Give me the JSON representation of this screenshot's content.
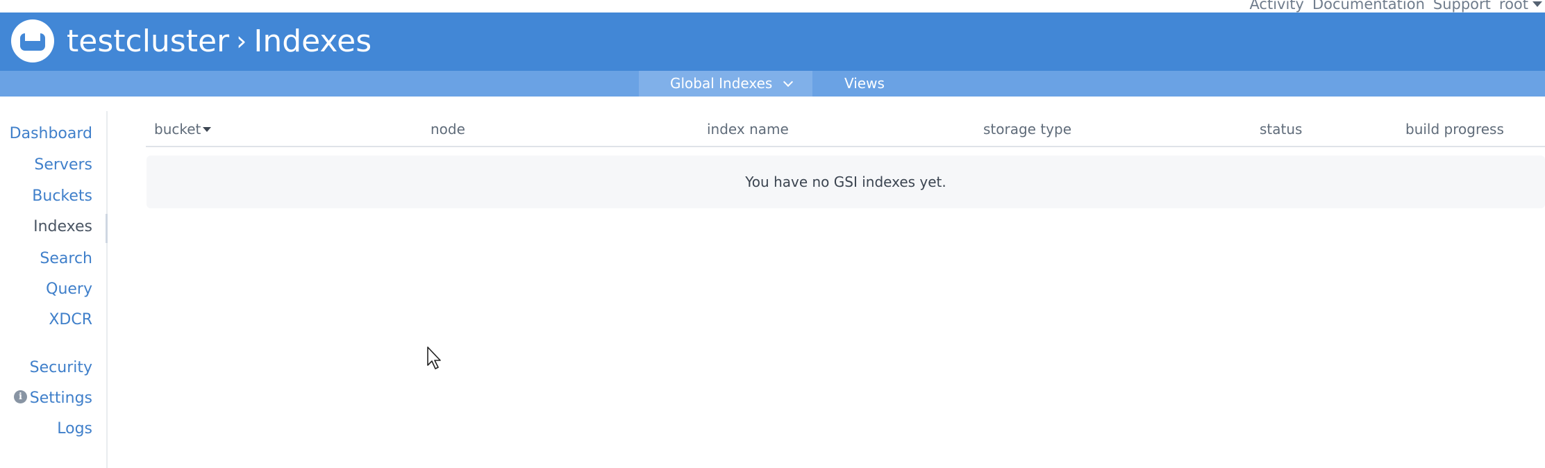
{
  "top_links": {
    "activity": "Activity",
    "documentation": "Documentation",
    "support": "Support",
    "user": "root"
  },
  "header": {
    "cluster": "testcluster",
    "separator": "›",
    "page": "Indexes",
    "bg_color": "#4287d6",
    "logo_icon": "couchbase-logo-icon"
  },
  "subnav": {
    "tabs": [
      {
        "label": "Global Indexes",
        "selected": true,
        "icon": "chevron-down-icon"
      },
      {
        "label": "Views",
        "selected": false
      }
    ],
    "bg_color": "#6aa2e4"
  },
  "sidebar": {
    "items": [
      {
        "label": "Dashboard",
        "active": false
      },
      {
        "label": "Servers",
        "active": false
      },
      {
        "label": "Buckets",
        "active": false
      },
      {
        "label": "Indexes",
        "active": true
      },
      {
        "label": "Search",
        "active": false
      },
      {
        "label": "Query",
        "active": false
      },
      {
        "label": "XDCR",
        "active": false
      },
      {
        "label": "Security",
        "active": false
      },
      {
        "label": "Settings",
        "active": false,
        "icon": "info-icon"
      },
      {
        "label": "Logs",
        "active": false
      }
    ],
    "link_color": "#3f7fca",
    "active_color": "#4a5563"
  },
  "table": {
    "columns": [
      "bucket",
      "node",
      "index name",
      "storage type",
      "status",
      "build progress"
    ],
    "sorted_column": "bucket",
    "empty_message": "You have no GSI indexes yet."
  }
}
